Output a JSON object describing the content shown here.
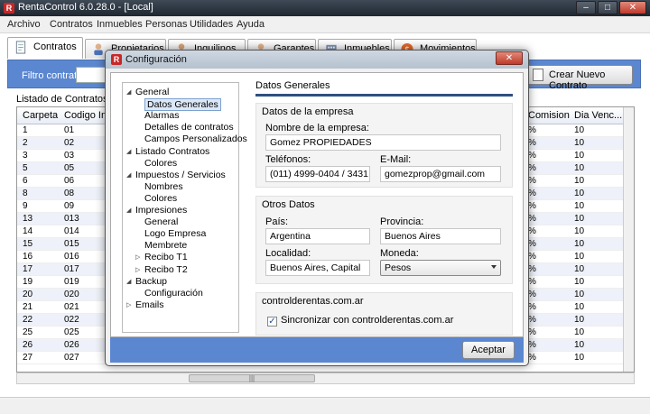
{
  "app": {
    "title": "RentaControl 6.0.28.0 - [Local]",
    "icon_letter": "R"
  },
  "menu": [
    "Archivo",
    "Contratos",
    "Inmuebles",
    "Personas",
    "Utilidades",
    "Ayuda"
  ],
  "tabs": [
    {
      "label": "Contratos",
      "icon": "contract-icon"
    },
    {
      "label": "Propietarios",
      "icon": "owner-icon"
    },
    {
      "label": "Inquilinos",
      "icon": "tenant-icon"
    },
    {
      "label": "Garantes",
      "icon": "guarantor-icon"
    },
    {
      "label": "Inmuebles",
      "icon": "building-icon"
    },
    {
      "label": "Movimientos",
      "icon": "movements-icon"
    }
  ],
  "filter": {
    "label": "Filtro contratos:",
    "value": ""
  },
  "new_contract_button": "Crear Nuevo Contrato",
  "list_title": "Listado de Contratos - R",
  "grid": {
    "headers": [
      "Carpeta",
      "Codigo Inte",
      "Comision",
      "Dia Venc..."
    ],
    "rows": [
      [
        "1",
        "01",
        "%",
        "10"
      ],
      [
        "2",
        "02",
        "%",
        "10"
      ],
      [
        "3",
        "03",
        "%",
        "10"
      ],
      [
        "5",
        "05",
        "%",
        "10"
      ],
      [
        "6",
        "06",
        "%",
        "10"
      ],
      [
        "8",
        "08",
        "%",
        "10"
      ],
      [
        "9",
        "09",
        "%",
        "10"
      ],
      [
        "13",
        "013",
        "%",
        "10"
      ],
      [
        "14",
        "014",
        "%",
        "10"
      ],
      [
        "15",
        "015",
        "%",
        "10"
      ],
      [
        "16",
        "016",
        "%",
        "10"
      ],
      [
        "17",
        "017",
        "%",
        "10"
      ],
      [
        "19",
        "019",
        "%",
        "10"
      ],
      [
        "20",
        "020",
        "%",
        "10"
      ],
      [
        "21",
        "021",
        "%",
        "10"
      ],
      [
        "22",
        "022",
        "%",
        "10"
      ],
      [
        "25",
        "025",
        "%",
        "10"
      ],
      [
        "26",
        "026",
        "%",
        "10"
      ],
      [
        "27",
        "027",
        "%",
        "10"
      ]
    ]
  },
  "dialog": {
    "title": "Configuración",
    "tree": [
      {
        "label": "General",
        "level": 0,
        "expanded": true
      },
      {
        "label": "Datos Generales",
        "level": 1,
        "selected": true
      },
      {
        "label": "Alarmas",
        "level": 1
      },
      {
        "label": "Detalles de contratos",
        "level": 1
      },
      {
        "label": "Campos Personalizados",
        "level": 1
      },
      {
        "label": "Listado Contratos",
        "level": 0,
        "expanded": true
      },
      {
        "label": "Colores",
        "level": 1
      },
      {
        "label": "Impuestos / Servicios",
        "level": 0,
        "expanded": true
      },
      {
        "label": "Nombres",
        "level": 1
      },
      {
        "label": "Colores",
        "level": 1
      },
      {
        "label": "Impresiones",
        "level": 0,
        "expanded": true
      },
      {
        "label": "General",
        "level": 1
      },
      {
        "label": "Logo Empresa",
        "level": 1
      },
      {
        "label": "Membrete",
        "level": 1
      },
      {
        "label": "Recibo T1",
        "level": 1,
        "collapsed": true
      },
      {
        "label": "Recibo T2",
        "level": 1,
        "collapsed": true
      },
      {
        "label": "Backup",
        "level": 0,
        "expanded": true
      },
      {
        "label": "Configuración",
        "level": 1
      },
      {
        "label": "Emails",
        "level": 0,
        "collapsed": true
      }
    ],
    "section_title": "Datos Generales",
    "empresa": {
      "group_title": "Datos de la empresa",
      "name_label": "Nombre de la empresa:",
      "name_value": "Gomez PROPIEDADES",
      "phone_label": "Teléfonos:",
      "phone_value": "(011) 4999-0404 / 3431",
      "email_label": "E-Mail:",
      "email_value": "gomezprop@gmail.com"
    },
    "otros": {
      "group_title": "Otros Datos",
      "country_label": "País:",
      "country_value": "Argentina",
      "province_label": "Provincia:",
      "province_value": "Buenos Aires",
      "city_label": "Localidad:",
      "city_value": "Buenos Aires, Capital",
      "currency_label": "Moneda:",
      "currency_value": "Pesos"
    },
    "sync": {
      "group_title": "controlderentas.com.ar",
      "checkbox_label": "Sincronizar con controlderentas.com.ar",
      "checked": true
    },
    "accept_button": "Aceptar"
  },
  "colors": {
    "accent_blue": "#5b87d0",
    "title_dark": "#2f4f80",
    "close_red": "#c0392b"
  }
}
